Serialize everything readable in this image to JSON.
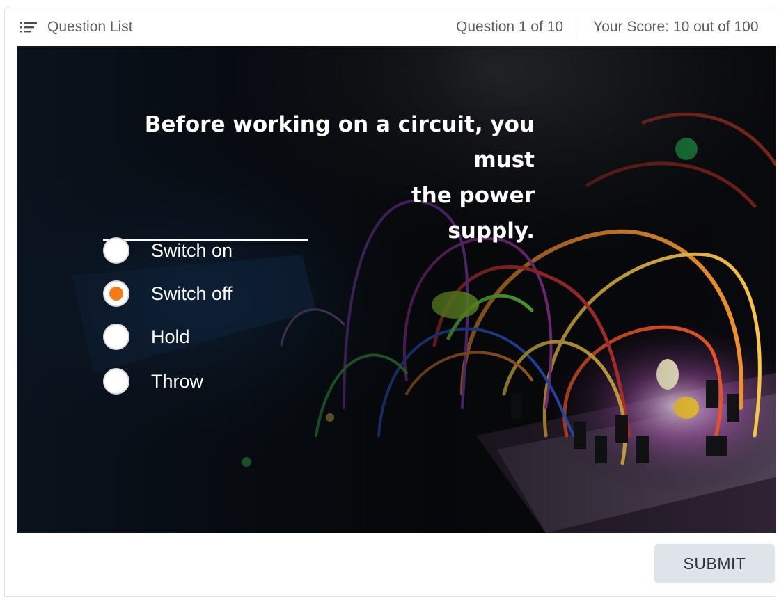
{
  "header": {
    "question_list_label": "Question List",
    "question_list_icon": "list-icon",
    "progress_text": "Question 1 of 10",
    "score_text": "Your Score: 10 out of 100"
  },
  "question": {
    "line1": "Before working on a circuit, you must",
    "line2": "the power supply."
  },
  "options": [
    {
      "label": "Switch on",
      "selected": false
    },
    {
      "label": "Switch off",
      "selected": true
    },
    {
      "label": "Hold",
      "selected": false
    },
    {
      "label": "Throw",
      "selected": false
    }
  ],
  "colors": {
    "selected_radio": "#f47b16",
    "submit_bg": "#dfe3ea"
  },
  "submit_label": "SUBMIT"
}
